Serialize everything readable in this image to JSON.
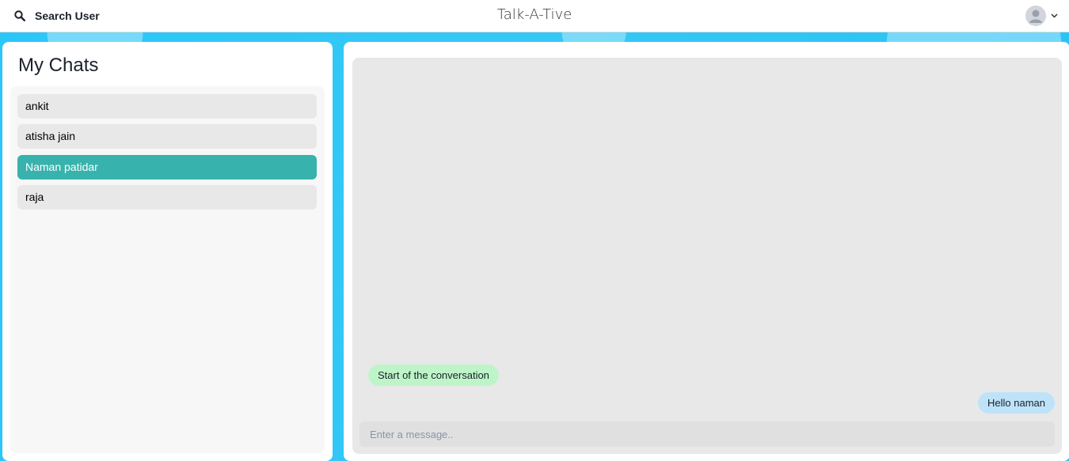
{
  "header": {
    "search_label": "Search User",
    "app_title": "Talk-A-Tive"
  },
  "sidebar": {
    "title": "My Chats",
    "chats": [
      {
        "name": "ankit",
        "active": false
      },
      {
        "name": "atisha jain",
        "active": false
      },
      {
        "name": "Naman patidar",
        "active": true
      },
      {
        "name": "raja",
        "active": false
      }
    ]
  },
  "conversation": {
    "messages": [
      {
        "text": "Start of the conversation",
        "direction": "incoming"
      },
      {
        "text": "Hello naman",
        "direction": "outgoing"
      }
    ],
    "input_placeholder": "Enter a message..",
    "input_value": ""
  },
  "colors": {
    "background": "#2bc6f8",
    "active_chat": "#38b2ac",
    "incoming_bubble": "#bef5c8",
    "outgoing_bubble": "#bee3f8"
  },
  "icons": {
    "search": "search-icon",
    "avatar": "user-avatar-icon",
    "menu": "chevron-down-icon"
  }
}
